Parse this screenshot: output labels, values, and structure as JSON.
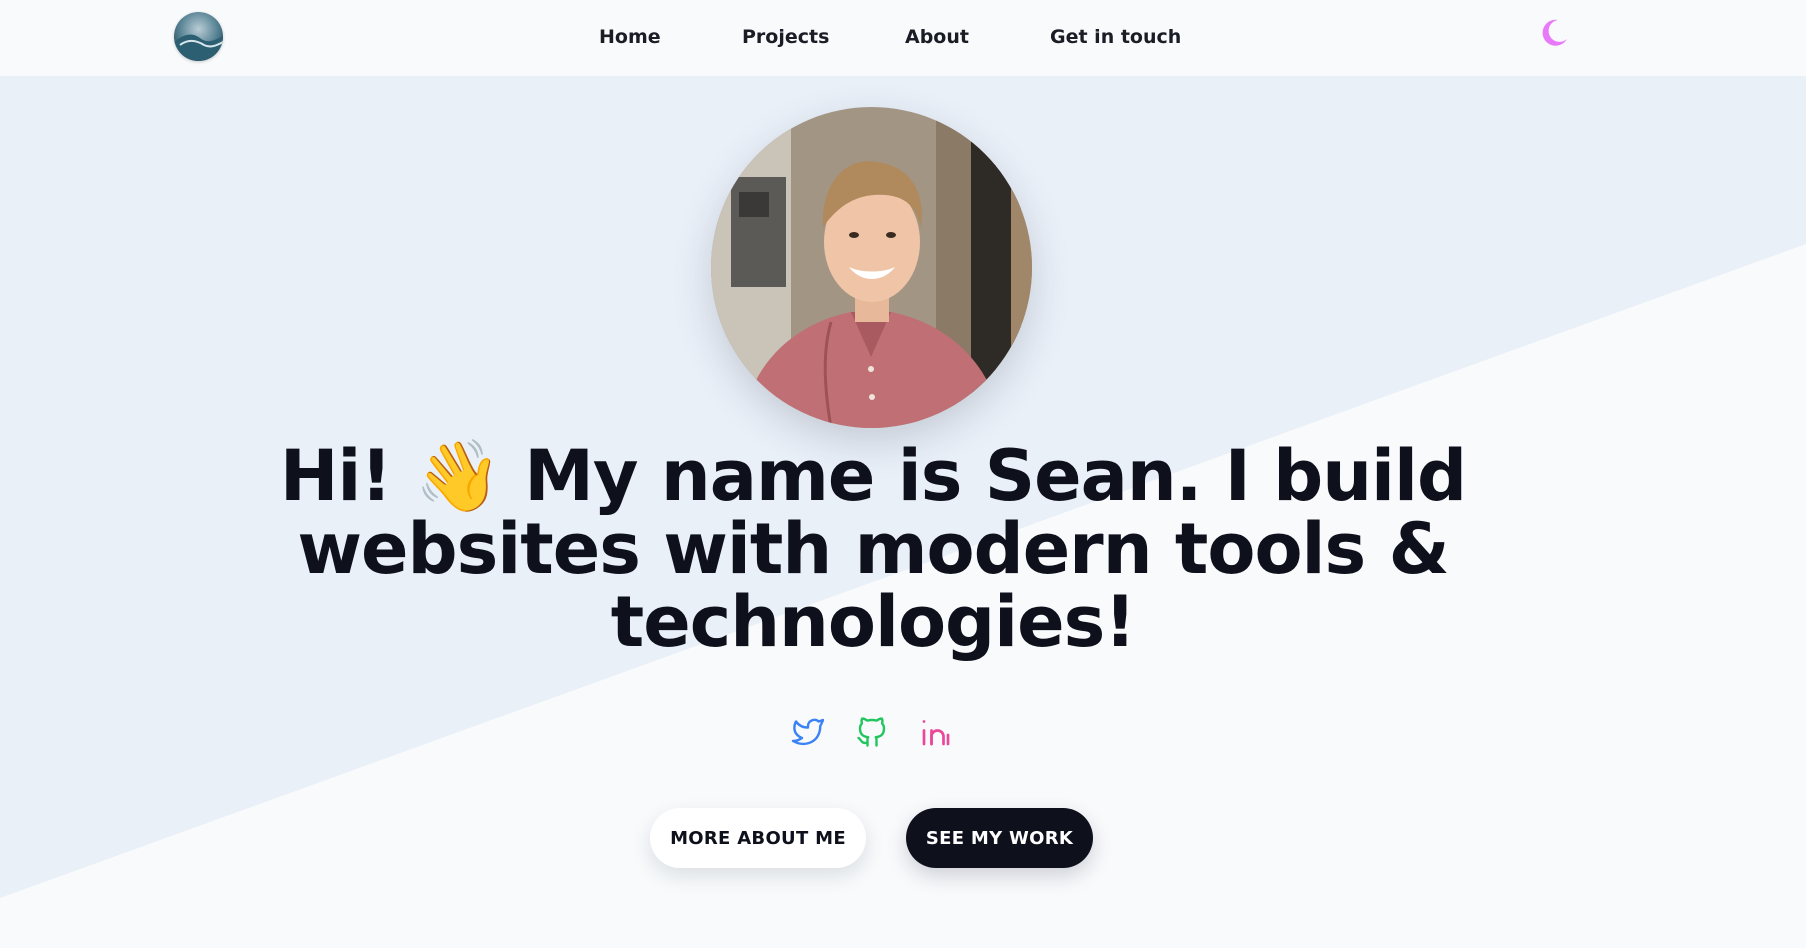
{
  "nav": {
    "home": "Home",
    "projects": "Projects",
    "about": "About",
    "contact": "Get in touch"
  },
  "theme_toggle": {
    "icon": "moon-icon",
    "color": "#e879f9"
  },
  "logo": {
    "icon": "wave-logo"
  },
  "avatar": {
    "icon": "profile-photo"
  },
  "hero": {
    "headline": "Hi! 👋 My name is Sean. I build websites with modern tools & technologies!"
  },
  "social": [
    {
      "icon": "twitter-icon",
      "color": "#3b82f6"
    },
    {
      "icon": "github-icon",
      "color": "#22c55e"
    },
    {
      "icon": "linkedin-icon",
      "color": "#ec4899"
    }
  ],
  "buttons": {
    "more_about": "MORE ABOUT ME",
    "see_work": "SEE MY WORK"
  },
  "colors": {
    "background": "#f8fafc",
    "diagonal": "#eaf0f8",
    "text": "#0e111c"
  }
}
